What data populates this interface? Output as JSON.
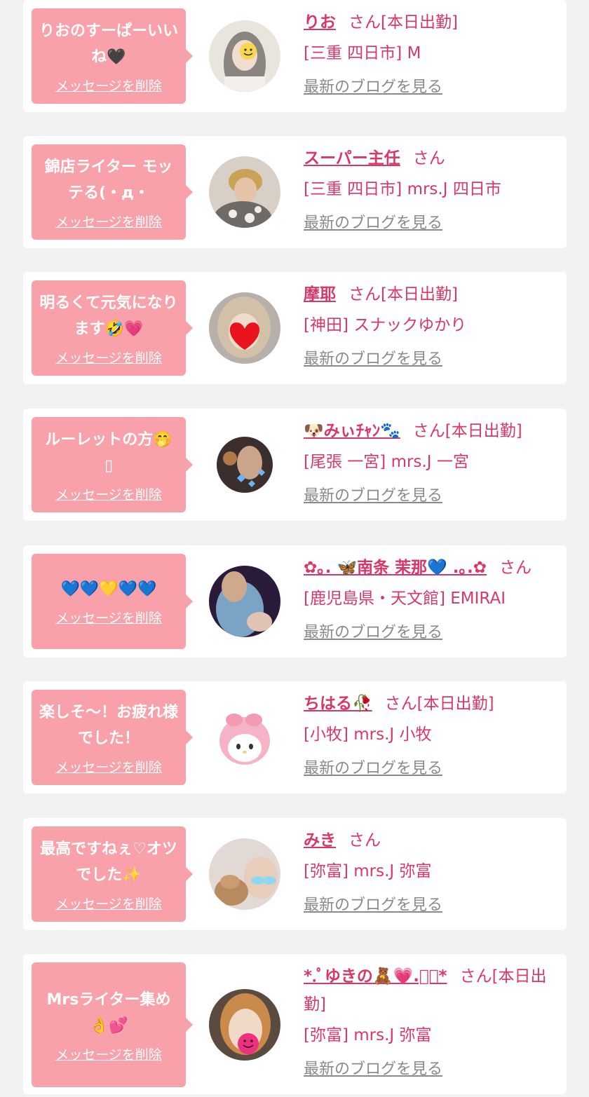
{
  "delete_label": "メッセージを削除",
  "blog_label": "最新のブログを見る",
  "colors": {
    "accent": "#d8376a",
    "bubble": "#f8a1aa",
    "card": "#ffffff",
    "page": "#f2f2f2"
  },
  "entries": [
    {
      "message": "りおのすーぱーいいね🖤",
      "name": "りお",
      "suffix": "さん[本日出勤]",
      "location": "[三重 四日市] M"
    },
    {
      "message": "錦店ライター モッテる(・д・",
      "name": "スーパー主任",
      "suffix": "さん",
      "location": "[三重 四日市] mrs.J 四日市"
    },
    {
      "message": "明るくて元気になります🤣💗",
      "name": "摩耶",
      "suffix": "さん[本日出勤]",
      "location": "[神田] スナックゆかり"
    },
    {
      "message": "ルーレットの方🤭 ▯",
      "name": "🐶みぃﾁｬﾝ🐾",
      "suffix": "さん[本日出勤]",
      "location": "[尾張 一宮] mrs.J 一宮"
    },
    {
      "message": "💙💙💛💙💙",
      "name": "✿｡. 🦋南条 茉那💙 .｡.✿",
      "suffix": "さん",
      "location": "[鹿児島県・天文館] EMIRAI"
    },
    {
      "message": "楽しそ〜！お疲れ様でした！",
      "name": "ちはる🥀",
      "suffix": "さん[本日出勤]",
      "location": "[小牧] mrs.J 小牧"
    },
    {
      "message": "最高ですねぇ♡オツでした✨",
      "name": "みき",
      "suffix": "さん",
      "location": "[弥富] mrs.J 弥富"
    },
    {
      "message": "Mrsライター集め👌💕",
      "name": "*.ﾟゆきの🧸💗.ﾟ･*",
      "suffix": "さん[本日出勤]",
      "location": "[弥富] mrs.J 弥富"
    }
  ]
}
